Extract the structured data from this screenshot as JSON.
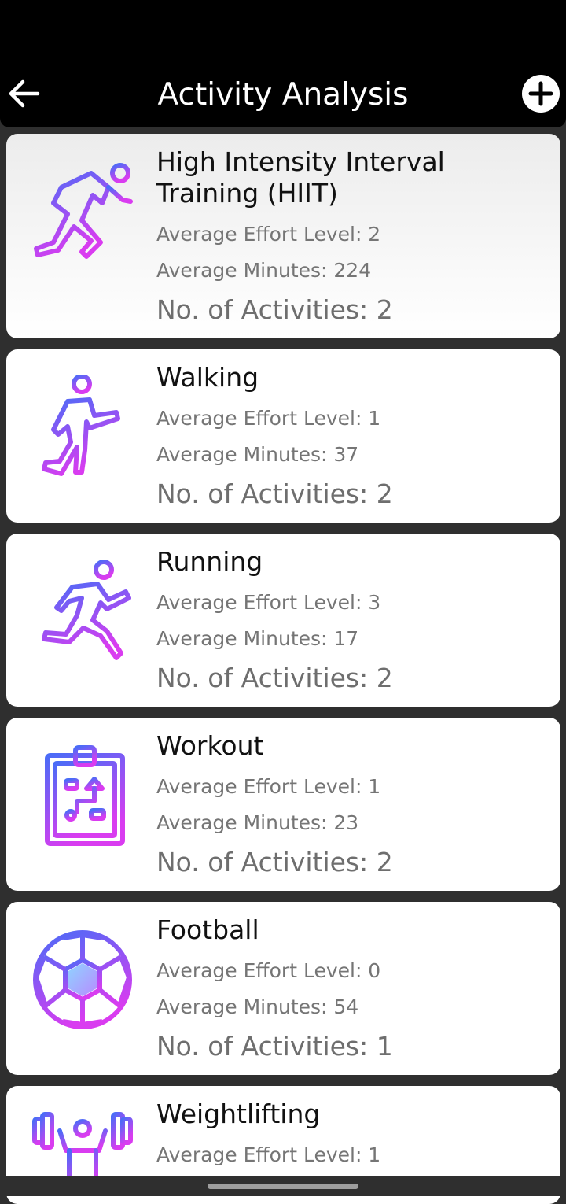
{
  "app_bar": {
    "title": "Activity Analysis",
    "back_icon": "arrow-left-icon",
    "add_icon": "plus-circle-icon"
  },
  "colors": {
    "gradient_start": "#4a6cf7",
    "gradient_end": "#d93cf0"
  },
  "activities": [
    {
      "name": "High Intensity Interval Training (HIIT)",
      "effort": "Average Effort Level: 2",
      "minutes": "Average Minutes: 224",
      "count": "No. of Activities: 2",
      "icon": "sprinter-icon"
    },
    {
      "name": "Walking",
      "effort": "Average Effort Level: 1",
      "minutes": "Average Minutes: 37",
      "count": "No. of Activities: 2",
      "icon": "walking-person-icon"
    },
    {
      "name": "Running",
      "effort": "Average Effort Level: 3",
      "minutes": "Average Minutes: 17",
      "count": "No. of Activities: 2",
      "icon": "running-person-icon"
    },
    {
      "name": "Workout",
      "effort": "Average Effort Level: 1",
      "minutes": "Average Minutes: 23",
      "count": "No. of Activities: 2",
      "icon": "clipboard-plan-icon"
    },
    {
      "name": "Football",
      "effort": "Average Effort Level: 0",
      "minutes": "Average Minutes: 54",
      "count": "No. of Activities: 1",
      "icon": "soccer-ball-icon"
    },
    {
      "name": "Weightlifting",
      "effort": "Average Effort Level: 1",
      "minutes": "",
      "count": "",
      "icon": "weightlifter-icon"
    }
  ]
}
